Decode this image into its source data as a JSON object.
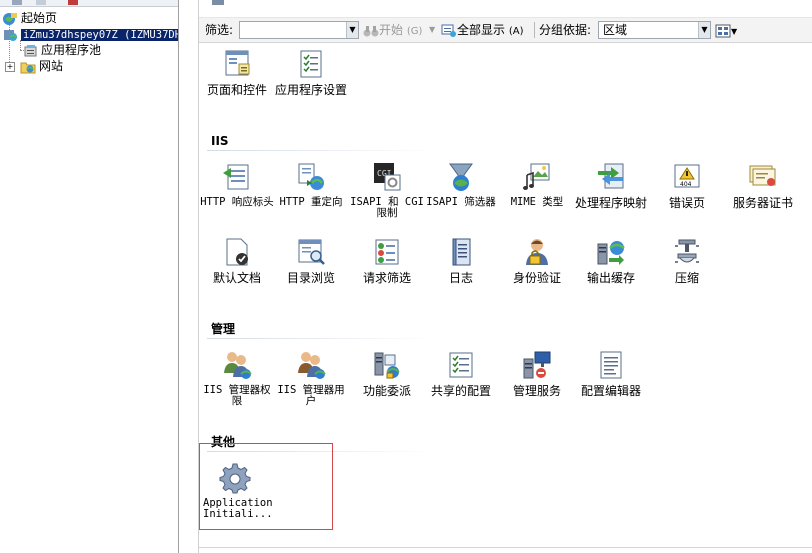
{
  "tree": {
    "items": [
      {
        "label": "起始页"
      },
      {
        "label": "iZmu37dhspey07Z (IZMU37DHS"
      },
      {
        "label": "应用程序池"
      },
      {
        "label": "网站"
      }
    ]
  },
  "filter_bar": {
    "filter_label": "筛选:",
    "start_label": "开始",
    "start_shortcut": "(G)",
    "show_all_label": "全部显示",
    "show_all_shortcut": "(A)",
    "group_by_label": "分组依据:",
    "group_by_value": "区域"
  },
  "sections": [
    {
      "title": "",
      "items": [
        {
          "label": "页面和控件",
          "icon": "page-controls-icon"
        },
        {
          "label": "应用程序设置",
          "icon": "app-settings-icon"
        }
      ]
    },
    {
      "title": "IIS",
      "items": [
        {
          "label": "HTTP 响应标头",
          "icon": "http-response-headers-icon"
        },
        {
          "label": "HTTP 重定向",
          "icon": "http-redirect-icon"
        },
        {
          "label": "ISAPI 和 CGI 限制",
          "icon": "isapi-cgi-icon"
        },
        {
          "label": "ISAPI 筛选器",
          "icon": "isapi-filter-icon"
        },
        {
          "label": "MIME 类型",
          "icon": "mime-types-icon"
        },
        {
          "label": "处理程序映射",
          "icon": "handler-mappings-icon"
        },
        {
          "label": "错误页",
          "icon": "error-pages-icon"
        },
        {
          "label": "服务器证书",
          "icon": "server-certificates-icon"
        },
        {
          "label": "默认文档",
          "icon": "default-document-icon"
        },
        {
          "label": "目录浏览",
          "icon": "directory-browsing-icon"
        },
        {
          "label": "请求筛选",
          "icon": "request-filtering-icon"
        },
        {
          "label": "日志",
          "icon": "logging-icon"
        },
        {
          "label": "身份验证",
          "icon": "authentication-icon"
        },
        {
          "label": "输出缓存",
          "icon": "output-caching-icon"
        },
        {
          "label": "压缩",
          "icon": "compression-icon"
        }
      ]
    },
    {
      "title": "管理",
      "items": [
        {
          "label": "IIS 管理器权限",
          "icon": "iis-manager-permissions-icon"
        },
        {
          "label": "IIS 管理器用户",
          "icon": "iis-manager-users-icon"
        },
        {
          "label": "功能委派",
          "icon": "feature-delegation-icon"
        },
        {
          "label": "共享的配置",
          "icon": "shared-configuration-icon"
        },
        {
          "label": "管理服务",
          "icon": "management-service-icon"
        },
        {
          "label": "配置编辑器",
          "icon": "configuration-editor-icon"
        }
      ]
    },
    {
      "title": "其他",
      "items": [
        {
          "label": "Application Initiali...",
          "icon": "gear-icon"
        }
      ]
    }
  ],
  "colors": {
    "selection": "#0a246a",
    "highlight_box": "#d9474b"
  }
}
